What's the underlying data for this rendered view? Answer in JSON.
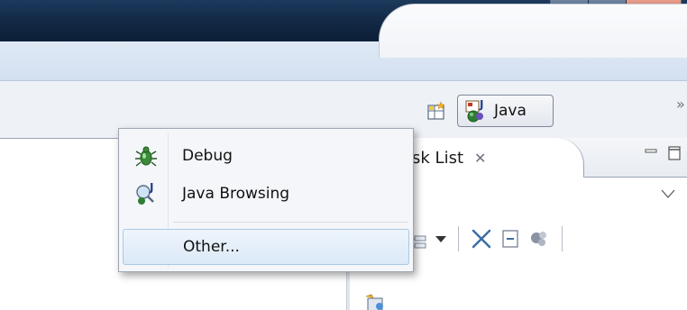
{
  "perspective": {
    "current_label": "Java",
    "more_indicator": "»"
  },
  "task_view": {
    "tab_label": "ask List",
    "close_glyph": "✕"
  },
  "perspective_menu": {
    "items": [
      {
        "label": "Debug",
        "icon": "debug-bug-icon"
      },
      {
        "label": "Java Browsing",
        "icon": "java-browsing-icon"
      },
      {
        "label": "Other...",
        "icon": ""
      }
    ]
  },
  "colors": {
    "title_bar": "#132a47",
    "close_button": "#c85a44",
    "menu_hover": "#dbe9f7"
  }
}
